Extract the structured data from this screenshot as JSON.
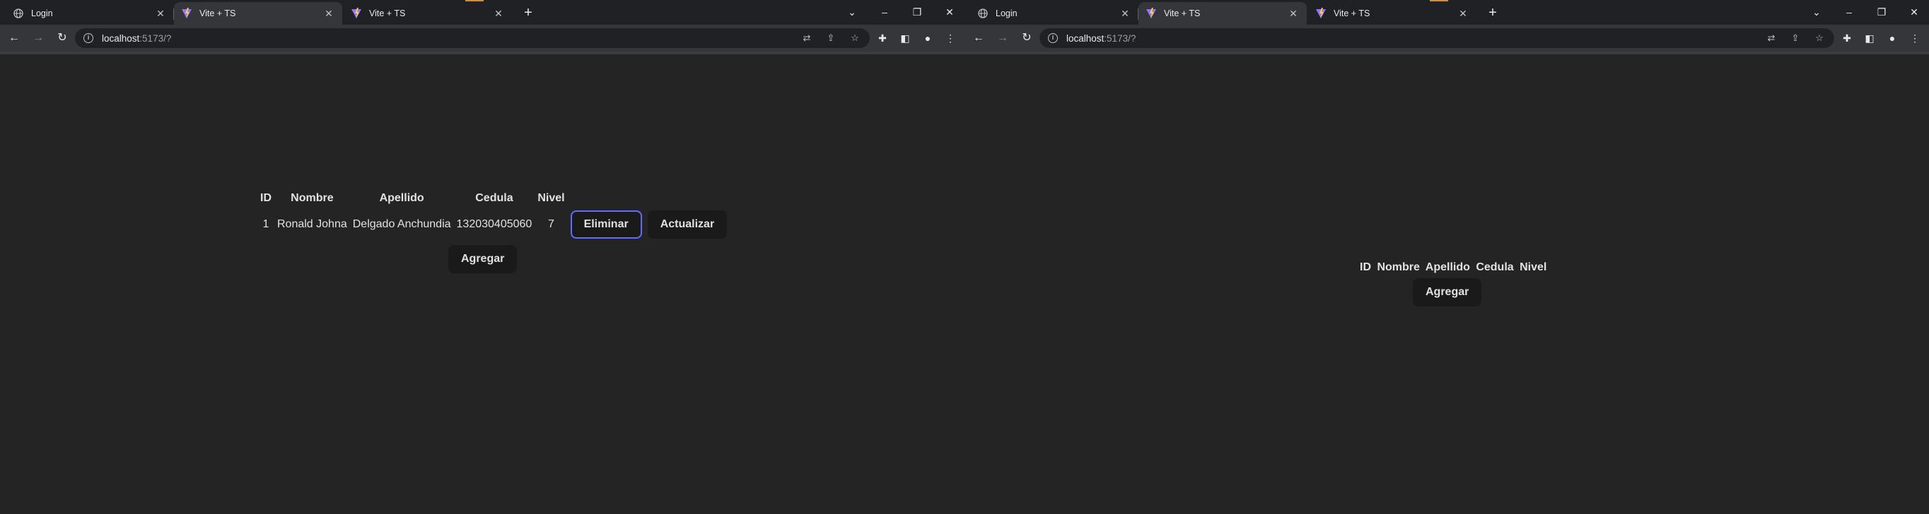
{
  "windows": [
    {
      "tabs": [
        {
          "title": "Login",
          "active": false,
          "favicon": "globe-icon"
        },
        {
          "title": "Vite + TS",
          "active": true,
          "favicon": "vite-logo"
        },
        {
          "title": "Vite + TS",
          "active": false,
          "favicon": "vite-logo"
        }
      ],
      "address": {
        "host": "localhost",
        "rest": ":5173/?"
      }
    },
    {
      "tabs": [
        {
          "title": "Login",
          "active": false,
          "favicon": "globe-icon"
        },
        {
          "title": "Vite + TS",
          "active": true,
          "favicon": "vite-logo"
        },
        {
          "title": "Vite + TS",
          "active": false,
          "favicon": "vite-logo"
        }
      ],
      "address": {
        "host": "localhost",
        "rest": ":5173/?"
      }
    }
  ],
  "left_page": {
    "table": {
      "headers": [
        "ID",
        "Nombre",
        "Apellido",
        "Cedula",
        "Nivel"
      ],
      "rows": [
        {
          "id": "1",
          "nombre": "Ronald Johna",
          "apellido": "Delgado Anchundia",
          "cedula": "132030405060",
          "nivel": "7",
          "eliminar_label": "Eliminar",
          "actualizar_label": "Actualizar"
        }
      ]
    },
    "agregar_label": "Agregar"
  },
  "right_page": {
    "headers": [
      "ID",
      "Nombre",
      "Apellido",
      "Cedula",
      "Nivel"
    ],
    "agregar_label": "Agregar"
  },
  "colors": {
    "page_bg": "#242424",
    "button_bg": "#1a1a1a",
    "focus_ring": "#646cff",
    "tabstrip_bg": "#202124",
    "toolbar_bg": "#35363a"
  }
}
